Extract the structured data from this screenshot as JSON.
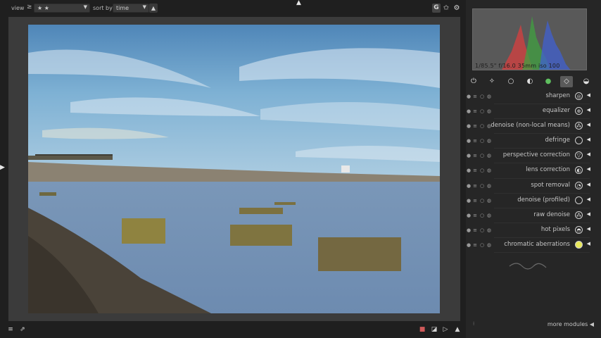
{
  "topbar": {
    "view_label": "view",
    "view_op": "≥",
    "view_value": "★ ★",
    "sort_label": "sort by",
    "sort_value": "time",
    "sort_dir_icon": "up-triangle-icon",
    "icons": [
      "grouping-icon",
      "star-overlay-icon",
      "preferences-gear-icon"
    ],
    "grouping_letter": "G"
  },
  "histogram": {
    "exif_text": "1/85.5\" f/16.0 35mm iso 100"
  },
  "module_groups": [
    "active-modules-icon",
    "favorites-icon",
    "basic-group-icon",
    "tone-group-icon",
    "color-group-icon",
    "correct-group-icon",
    "effect-group-icon"
  ],
  "modules": [
    {
      "name": "sharpen",
      "icon": "sharpen-icon",
      "glyph": "◎"
    },
    {
      "name": "equalizer",
      "icon": "equalizer-icon",
      "glyph": "⊕"
    },
    {
      "name": "denoise (non-local means)",
      "icon": "denoise-nlm-icon",
      "glyph": "⁂"
    },
    {
      "name": "defringe",
      "icon": "defringe-icon",
      "glyph": ""
    },
    {
      "name": "perspective correction",
      "icon": "perspective-icon",
      "glyph": "▽"
    },
    {
      "name": "lens correction",
      "icon": "lens-icon",
      "glyph": "◐"
    },
    {
      "name": "spot removal",
      "icon": "spot-removal-icon",
      "glyph": "◔"
    },
    {
      "name": "denoise (profiled)",
      "icon": "denoise-profiled-icon",
      "glyph": ""
    },
    {
      "name": "raw denoise",
      "icon": "raw-denoise-icon",
      "glyph": "⁂"
    },
    {
      "name": "hot pixels",
      "icon": "hot-pixels-icon",
      "glyph": "◓"
    },
    {
      "name": "chromatic aberrations",
      "icon": "chromatic-aberrations-icon",
      "glyph": "●"
    }
  ],
  "footer": {
    "more_modules": "more modules"
  },
  "bottombar": {
    "icons": [
      "menu-icon",
      "filmstrip-icon",
      "softproof-icon",
      "gamut-check-icon",
      "style-icon",
      "warning-icon"
    ]
  },
  "colors": {
    "accent_active_tab": "#5a5a5a",
    "panel_bg": "#262626",
    "frame_bg": "#3b3b3b",
    "ca_icon": "#e8e85a"
  }
}
